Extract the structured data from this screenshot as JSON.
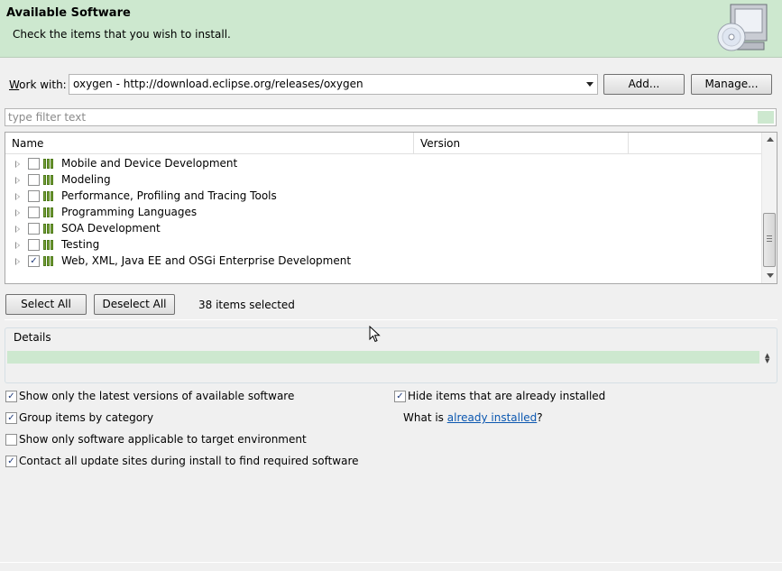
{
  "banner": {
    "title": "Available Software",
    "message": "Check the items that you wish to install."
  },
  "work_with": {
    "label_prefix": "",
    "label_mnemonic": "W",
    "label_rest": "ork with:",
    "value": "oxygen - http://download.eclipse.org/releases/oxygen",
    "add_button": "Add...",
    "manage_button": "Manage..."
  },
  "filter": {
    "placeholder": "type filter text"
  },
  "table": {
    "columns": [
      "Name",
      "Version"
    ],
    "rows": [
      {
        "name": "Mobile and Device Development",
        "checked": false
      },
      {
        "name": "Modeling",
        "checked": false
      },
      {
        "name": "Performance, Profiling and Tracing Tools",
        "checked": false
      },
      {
        "name": "Programming Languages",
        "checked": false
      },
      {
        "name": "SOA Development",
        "checked": false
      },
      {
        "name": "Testing",
        "checked": false
      },
      {
        "name": "Web, XML, Java EE and OSGi Enterprise Development",
        "checked": true
      }
    ],
    "scroll_position_fraction": 0.85
  },
  "selection": {
    "select_all": "Select All",
    "deselect_all": "Deselect All",
    "status": "38 items selected"
  },
  "details": {
    "legend": "Details"
  },
  "options": {
    "latest_versions": {
      "text": "Show only the latest versions of available software",
      "checked": true
    },
    "group_by_category": {
      "text": "Group items by category",
      "checked": true
    },
    "target_environment": {
      "text": "Show only software applicable to target environment",
      "checked": false
    },
    "contact_sites": {
      "text": "Contact all update sites during install to find required software",
      "checked": true
    },
    "hide_installed": {
      "text": "Hide items that are already installed",
      "checked": true
    },
    "what_is_prefix": "What is ",
    "what_is_link": "already installed",
    "what_is_suffix": "?"
  },
  "colors": {
    "banner_bg": "#cde8cf",
    "link": "#0b57b0",
    "window_bg": "#f0f0f0"
  },
  "icons": [
    "computer-cd-icon",
    "category-icon",
    "expand-arrow-icon",
    "mouse-pointer-icon"
  ]
}
